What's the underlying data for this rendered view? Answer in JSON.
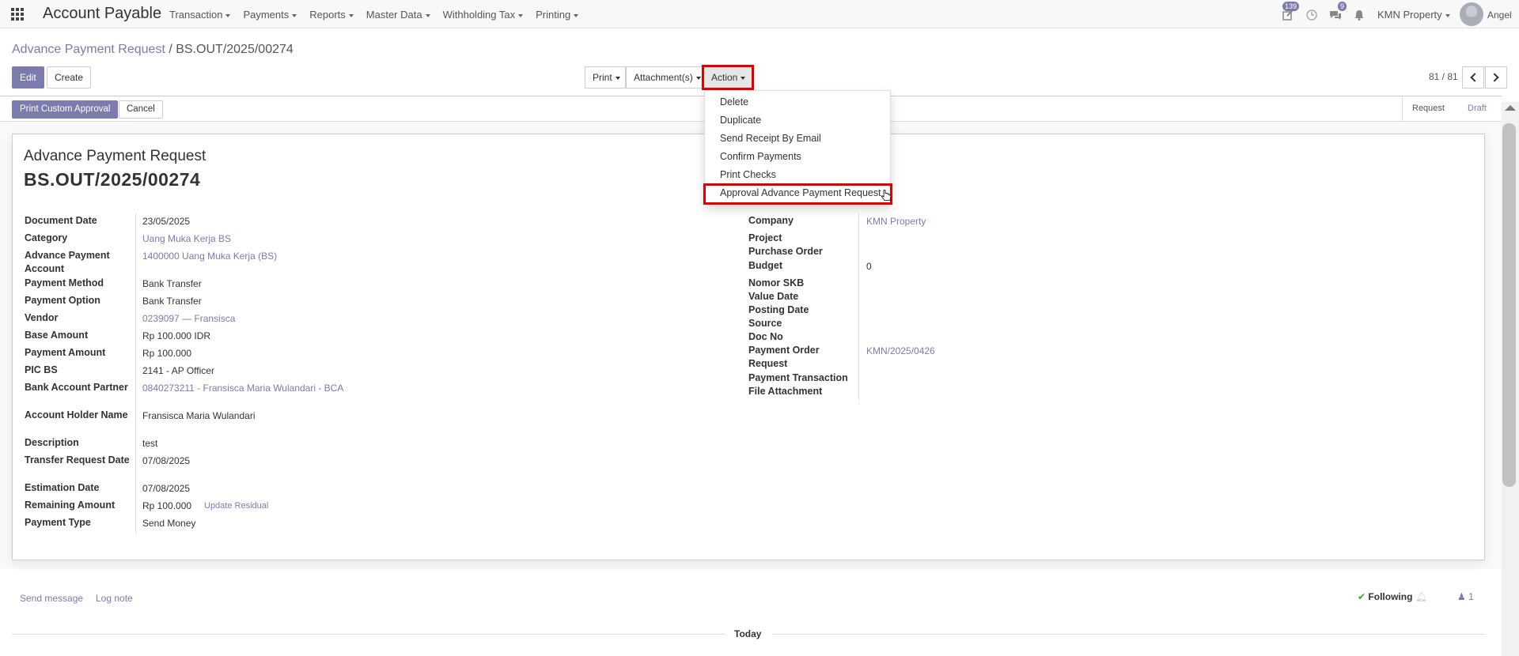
{
  "navbar": {
    "app_title": "Account Payable",
    "menu": [
      "Transaction",
      "Payments",
      "Reports",
      "Master Data",
      "Withholding Tax",
      "Printing"
    ],
    "badge_activity": "139",
    "badge_messages": "9",
    "company": "KMN Property",
    "user": "Angel"
  },
  "breadcrumb": {
    "parent": "Advance Payment Request",
    "separator": "/",
    "current": "BS.OUT/2025/00274"
  },
  "buttons": {
    "edit": "Edit",
    "create": "Create",
    "print": "Print",
    "attachments": "Attachment(s)",
    "action": "Action",
    "print_custom_approval": "Print Custom Approval",
    "cancel": "Cancel"
  },
  "pager": {
    "value": "81 / 81"
  },
  "status_stages": [
    "Request",
    "Draft"
  ],
  "action_menu": {
    "items": [
      "Delete",
      "Duplicate",
      "Send Receipt By Email",
      "Confirm Payments",
      "Print Checks",
      "Approval Advance Payment Request"
    ]
  },
  "form": {
    "title": "Advance Payment Request",
    "name": "BS.OUT/2025/00274",
    "left": [
      {
        "label": "Document Date",
        "value": "23/05/2025"
      },
      {
        "label": "Category",
        "value": "Uang Muka Kerja BS"
      },
      {
        "label": "Advance Payment Account",
        "value": "1400000 Uang Muka Kerja (BS)"
      },
      {
        "label": "Payment Method",
        "value": "Bank Transfer"
      },
      {
        "label": "Payment Option",
        "value": "Bank Transfer"
      },
      {
        "label": "Vendor",
        "value": "0239097 — Fransisca"
      },
      {
        "label": "Base Amount",
        "value": "Rp 100.000 IDR"
      },
      {
        "label": "Payment Amount",
        "value": "Rp 100.000"
      },
      {
        "label": "PIC BS",
        "value": "2141 - AP Officer"
      },
      {
        "label": "Bank Account Partner",
        "value": "0840273211 - Fransisca Maria Wulandari - BCA"
      },
      {
        "label": "Account Holder Name",
        "value": "Fransisca Maria Wulandari"
      },
      {
        "label": "Description",
        "value": "test"
      },
      {
        "label": "Transfer Request Date",
        "value": "07/08/2025"
      },
      {
        "label": "Estimation Date",
        "value": "07/08/2025"
      },
      {
        "label": "Remaining Amount",
        "value": "Rp 100.000",
        "extra": "Update Residual"
      },
      {
        "label": "Payment Type",
        "value": "Send Money"
      }
    ],
    "right": [
      {
        "label": "Company",
        "value": "KMN Property"
      },
      {
        "label": "Project",
        "value": ""
      },
      {
        "label": "Purchase Order",
        "value": ""
      },
      {
        "label": "Budget",
        "value": "0"
      },
      {
        "label": "Nomor SKB",
        "value": ""
      },
      {
        "label": "Value Date",
        "value": ""
      },
      {
        "label": "Posting Date",
        "value": ""
      },
      {
        "label": "Source",
        "value": ""
      },
      {
        "label": "Doc No",
        "value": ""
      },
      {
        "label": "Payment Order Request",
        "value": "KMN/2025/0426"
      },
      {
        "label": "Payment Transaction",
        "value": ""
      },
      {
        "label": "File Attachment",
        "value": ""
      }
    ]
  },
  "chatter": {
    "send_message": "Send message",
    "log_note": "Log note",
    "following": "Following",
    "followers": "1",
    "today": "Today"
  },
  "colors": {
    "primary": "#7c7bad",
    "highlight": "#e00000"
  }
}
